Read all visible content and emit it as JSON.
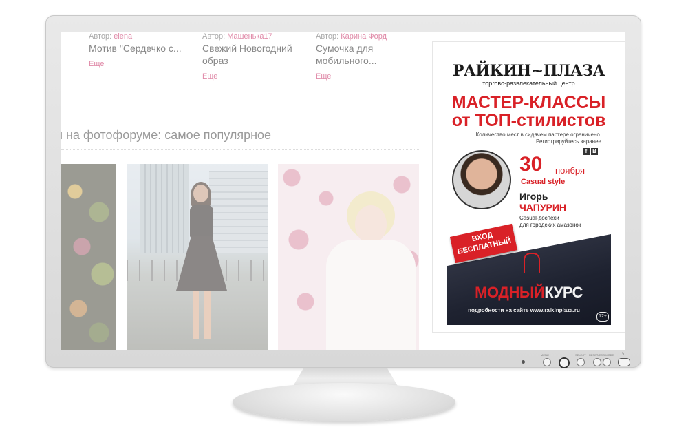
{
  "articles": [
    {
      "author_label": "Автор:",
      "author": "elena",
      "title": "Мотив \"Сердечко с...",
      "more": "Еще"
    },
    {
      "author_label": "Автор:",
      "author": "Машенька17",
      "title": "Свежий Новогодний образ",
      "more": "Еще"
    },
    {
      "author_label": "Автор:",
      "author": "Карина Форд",
      "title": "Сумочка для мобильного...",
      "more": "Еще"
    }
  ],
  "section_heading": "и на фотофоруме: самое популярное",
  "ad": {
    "brand": "РАЙКИН~ПЛАЗА",
    "brand_sub": "торгово-развлекательный центр",
    "headline_1": "МАСТЕР-КЛАССЫ",
    "headline_2": "от ТОП-стилистов",
    "note_1": "Количество мест в сидячем партере ограничено.",
    "note_2": "Регистрируйтесь заранее",
    "social_1": "f",
    "social_2": "B",
    "date": "30",
    "month": "ноября",
    "style": "Casual style",
    "first_name": "Игорь",
    "last_name": "ЧАПУРИН",
    "desc_1": "Casual-доспехи",
    "desc_2": "для городских амазонок",
    "ribbon_1": "ВХОД",
    "ribbon_2": "БЕСПЛАТНЫЙ",
    "course_a": "МОДНЫЙ",
    "course_b": "КУРС",
    "site": "подробности на сайте www.raikinplaza.ru",
    "age": "12+"
  },
  "monitor": {
    "btn_menu": "MENU",
    "btn_select": "SELECT",
    "btn_reset": "RESET/ECO MODE"
  },
  "colors": {
    "accent_pink": "#e08aa8",
    "ad_red": "#d92127"
  }
}
